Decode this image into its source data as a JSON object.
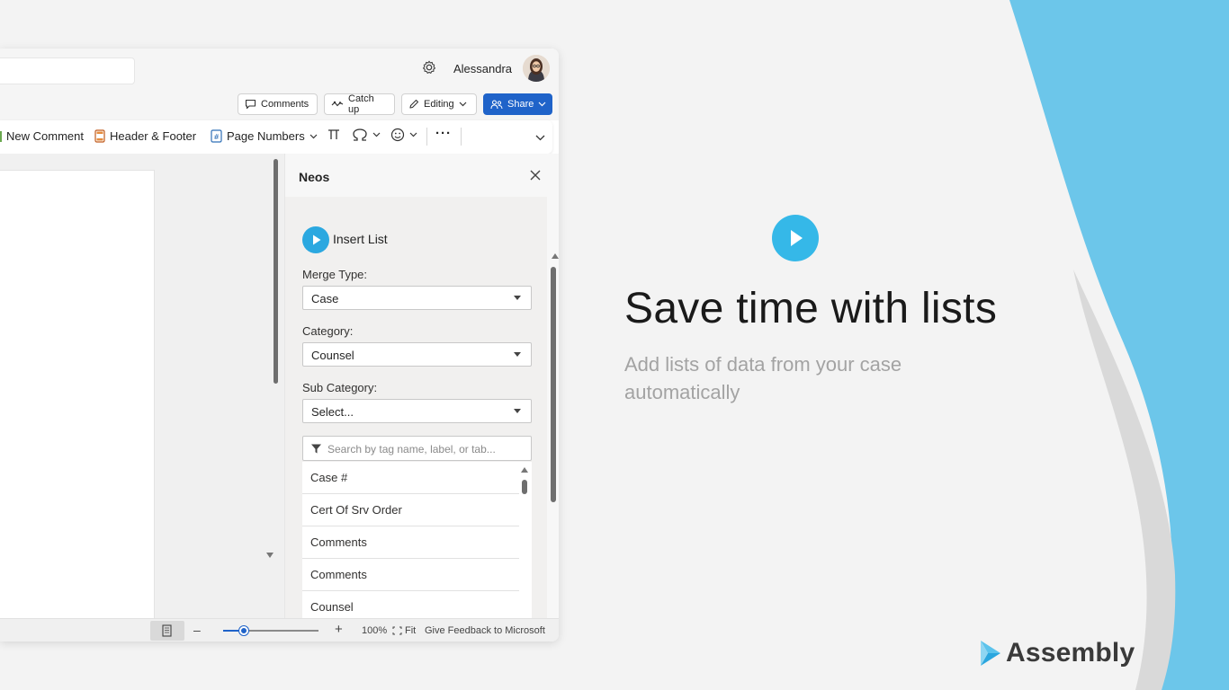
{
  "titlebar": {
    "user_name": "Alessandra"
  },
  "commandbar": {
    "comments_label": "Comments",
    "catchup_label": "Catch up",
    "editing_label": "Editing",
    "share_label": "Share"
  },
  "ribbon": {
    "new_comment": "New Comment",
    "header_footer": "Header & Footer",
    "page_numbers": "Page Numbers",
    "more": "···"
  },
  "pane": {
    "title": "Neos",
    "insert_title": "Insert List",
    "merge_type_label": "Merge Type:",
    "merge_type_value": "Case",
    "category_label": "Category:",
    "category_value": "Counsel",
    "subcategory_label": "Sub Category:",
    "subcategory_value": "Select...",
    "search_placeholder": "Search by tag name, label, or tab...",
    "items": [
      "Case #",
      "Cert Of Srv Order",
      "Comments",
      "Comments",
      "Counsel"
    ]
  },
  "statusbar": {
    "zoom_minus": "–",
    "zoom_plus": "+",
    "zoom_percent": "100%",
    "zoom_level": 0.22,
    "fit_label": "Fit",
    "feedback": "Give Feedback to Microsoft"
  },
  "promo": {
    "title": "Save time with lists",
    "subtitle": "Add lists of data from your case automatically",
    "brand": "Assembly"
  },
  "colors": {
    "accent_blue": "#1f63c9",
    "promo_play": "#35b8e8",
    "sky_shape": "#6cc6ea",
    "gray_shape": "#d9d9d9"
  },
  "icons": [
    "gear-icon",
    "avatar",
    "comment-icon",
    "catchup-icon",
    "pencil-icon",
    "share-people-icon",
    "chevron-down-icon",
    "header-footer-icon",
    "page-number-icon",
    "equation-icon",
    "omega-icon",
    "emoji-icon",
    "close-icon",
    "play-icon",
    "filter-icon",
    "assembly-logo-icon"
  ]
}
